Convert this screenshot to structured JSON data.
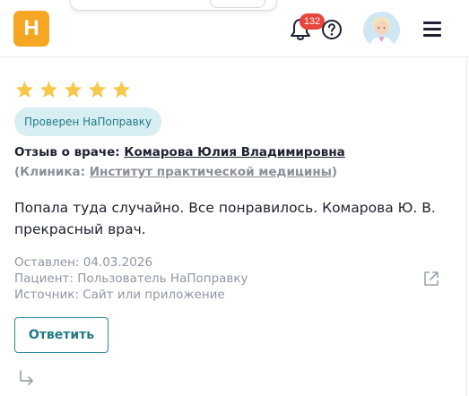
{
  "header": {
    "logo_letter": "Н",
    "notifications_count": "132",
    "colors": {
      "logo": "#f5a623",
      "badge": "#e8453c"
    }
  },
  "review": {
    "rating": 5,
    "rating_max": 5,
    "verified_label": "Проверен НаПоправку",
    "doctor_prefix": "Отзыв о враче: ",
    "doctor_name": "Комарова Юлия Владимировна",
    "clinic_open": "(Клиника: ",
    "clinic_name": "Институт практической медицины",
    "clinic_close": ")",
    "text": "Попала туда случайно. Все понравилось. Комарова Ю. В. прекрасный врач.",
    "meta": {
      "left": "Оставлен: 04.03.2026",
      "patient": "Пациент: Пользователь НаПоправку",
      "source": "Источник: Сайт или приложение"
    },
    "reply_label": "Ответить",
    "colors": {
      "star": "#f8c84a",
      "accent": "#1f7a86",
      "badge_bg": "#d7eff2"
    }
  }
}
